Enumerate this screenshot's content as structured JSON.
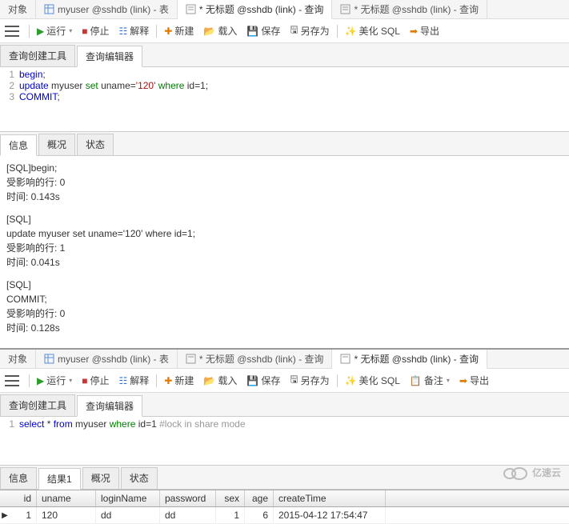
{
  "top": {
    "tabs": [
      {
        "label": "对象"
      },
      {
        "label": "myuser @sshdb (link) - 表"
      },
      {
        "label": "* 无标题 @sshdb (link) - 查询",
        "active": true
      },
      {
        "label": "* 无标题 @sshdb (link) - 查询"
      }
    ],
    "toolbar": {
      "run": "运行",
      "stop": "停止",
      "explain": "解释",
      "new": "新建",
      "load": "载入",
      "save": "保存",
      "saveas": "另存为",
      "beautify": "美化 SQL",
      "export": "导出"
    },
    "subtabs": [
      "查询创建工具",
      "查询编辑器"
    ],
    "code": [
      {
        "n": "1",
        "tokens": [
          {
            "t": "begin",
            "c": "kw-blue"
          },
          {
            "t": ";",
            "c": ""
          }
        ]
      },
      {
        "n": "2",
        "tokens": [
          {
            "t": "update",
            "c": "kw-blue"
          },
          {
            "t": " myuser ",
            "c": ""
          },
          {
            "t": "set",
            "c": "kw-green"
          },
          {
            "t": " uname=",
            "c": ""
          },
          {
            "t": "'120'",
            "c": "kw-str"
          },
          {
            "t": " ",
            "c": ""
          },
          {
            "t": "where",
            "c": "kw-green"
          },
          {
            "t": " id=",
            "c": ""
          },
          {
            "t": "1",
            "c": ""
          },
          {
            "t": ";",
            "c": ""
          }
        ]
      },
      {
        "n": "3",
        "tokens": [
          {
            "t": "COMMIT",
            "c": "kw-blue"
          },
          {
            "t": ";",
            "c": ""
          }
        ]
      }
    ],
    "result_tabs": [
      "信息",
      "概况",
      "状态"
    ],
    "messages": [
      [
        "[SQL]begin;",
        "受影响的行: 0",
        "时间: 0.143s"
      ],
      [
        "[SQL]",
        "update myuser set uname='120' where id=1;",
        "受影响的行: 1",
        "时间: 0.041s"
      ],
      [
        "[SQL]",
        "COMMIT;",
        "受影响的行: 0",
        "时间: 0.128s"
      ]
    ]
  },
  "bottom": {
    "tabs": [
      {
        "label": "对象"
      },
      {
        "label": "myuser @sshdb (link) - 表"
      },
      {
        "label": "* 无标题 @sshdb (link) - 查询"
      },
      {
        "label": "* 无标题 @sshdb (link) - 查询",
        "active": true
      }
    ],
    "toolbar": {
      "run": "运行",
      "stop": "停止",
      "explain": "解释",
      "new": "新建",
      "load": "载入",
      "save": "保存",
      "saveas": "另存为",
      "beautify": "美化 SQL",
      "notes": "备注",
      "export": "导出"
    },
    "subtabs": [
      "查询创建工具",
      "查询编辑器"
    ],
    "code": [
      {
        "n": "1",
        "tokens": [
          {
            "t": "select",
            "c": "kw-blue"
          },
          {
            "t": " * ",
            "c": ""
          },
          {
            "t": "from",
            "c": "kw-blue"
          },
          {
            "t": " myuser ",
            "c": ""
          },
          {
            "t": "where",
            "c": "kw-green"
          },
          {
            "t": " id=",
            "c": ""
          },
          {
            "t": "1",
            "c": ""
          },
          {
            "t": " ",
            "c": ""
          },
          {
            "t": "#lock in share mode",
            "c": "kw-gray"
          }
        ]
      }
    ],
    "result_tabs": [
      "信息",
      "结果1",
      "概况",
      "状态"
    ],
    "grid": {
      "headers": [
        "id",
        "uname",
        "loginName",
        "password",
        "sex",
        "age",
        "createTime"
      ],
      "rows": [
        {
          "id": "1",
          "uname": "120",
          "loginName": "dd",
          "password": "dd",
          "sex": "1",
          "age": "6",
          "createTime": "2015-04-12 17:54:47"
        }
      ]
    }
  },
  "watermark": "亿速云"
}
